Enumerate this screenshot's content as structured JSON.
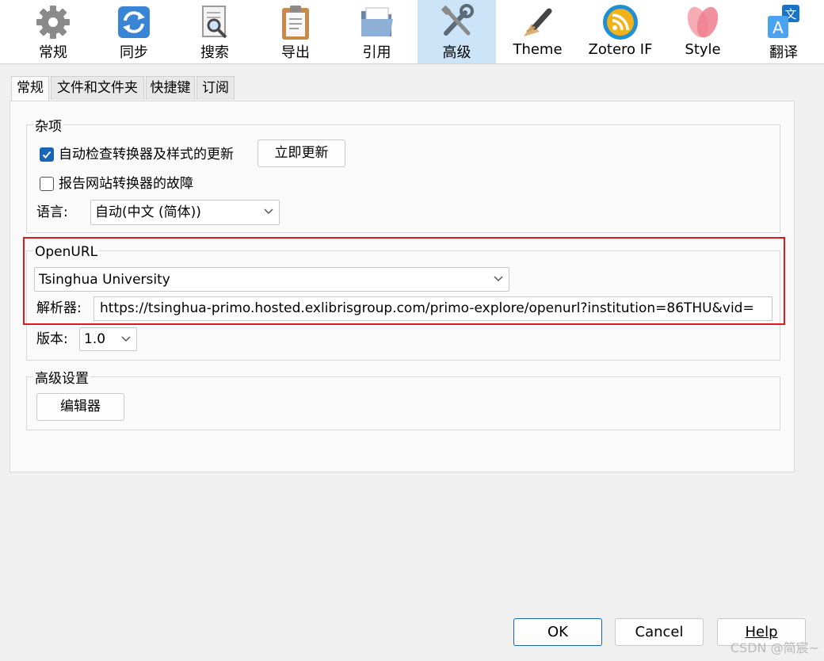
{
  "toolbar": {
    "items": [
      {
        "label": "常规",
        "icon": "gear-icon"
      },
      {
        "label": "同步",
        "icon": "sync-icon"
      },
      {
        "label": "搜索",
        "icon": "search-doc-icon"
      },
      {
        "label": "导出",
        "icon": "clipboard-icon"
      },
      {
        "label": "引用",
        "icon": "folder-icon"
      },
      {
        "label": "高级",
        "icon": "tools-icon",
        "selected": true
      },
      {
        "label": "Theme",
        "icon": "brush-icon"
      },
      {
        "label": "Zotero IF",
        "icon": "rss-icon"
      },
      {
        "label": "Style",
        "icon": "petals-icon"
      },
      {
        "label": "翻译",
        "icon": "translate-icon"
      }
    ]
  },
  "tabs": [
    {
      "label": "常规",
      "selected": true
    },
    {
      "label": "文件和文件夹"
    },
    {
      "label": "快捷键"
    },
    {
      "label": "订阅"
    }
  ],
  "misc": {
    "legend": "杂项",
    "auto_check_label": "自动检查转换器及样式的更新",
    "auto_check_checked": true,
    "update_now": "立即更新",
    "report_label": "报告网站转换器的故障",
    "report_checked": false,
    "language_label": "语言:",
    "language_value": "自动(中文 (简体))"
  },
  "openurl": {
    "legend": "OpenURL",
    "institution": "Tsinghua University",
    "resolver_label": "解析器:",
    "resolver_url": "https://tsinghua-primo.hosted.exlibrisgroup.com/primo-explore/openurl?institution=86THU&vid=",
    "version_label": "版本:",
    "version_value": "1.0"
  },
  "advanced": {
    "legend": "高级设置",
    "editor_button": "编辑器"
  },
  "footer": {
    "ok": "OK",
    "cancel": "Cancel",
    "help": "Help"
  },
  "watermark": "CSDN @简宸~",
  "colors": {
    "selected_toolbar_bg": "#cce4f7",
    "checkbox_accent": "#1a64b4",
    "highlight_box": "#e0191f"
  }
}
